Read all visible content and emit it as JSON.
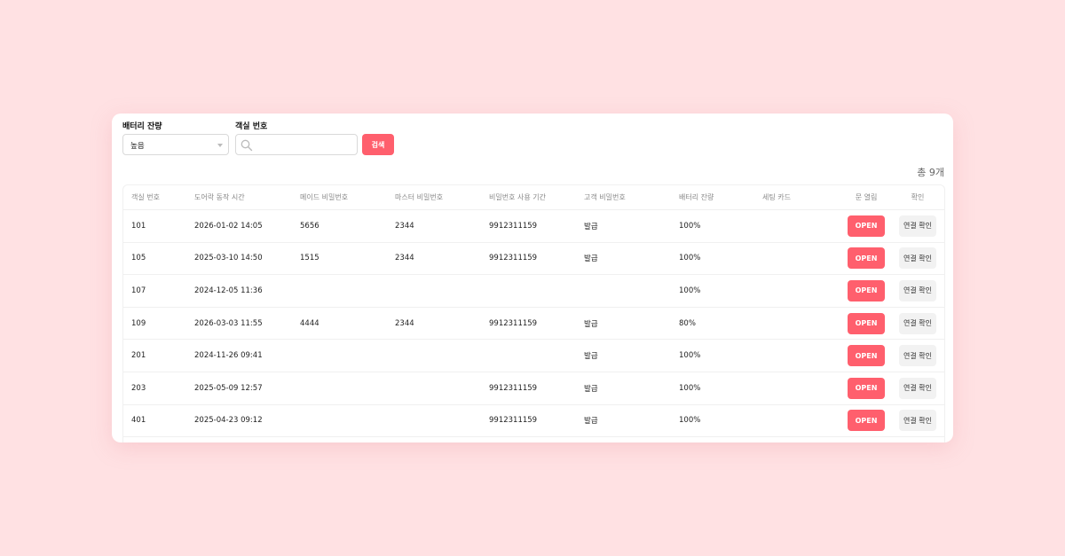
{
  "filters": {
    "battery_label": "배터리 잔량",
    "battery_value": "높음",
    "room_label": "객실 번호",
    "room_value": "",
    "search_button": "검색"
  },
  "total_count": "총 9개",
  "table": {
    "headers": [
      "객실 번호",
      "도어락 동작 시간",
      "메이드 비밀번호",
      "마스터 비밀번호",
      "비밀번호 사용 기간",
      "고객 비밀번호",
      "배터리 잔량",
      "세팅 카드",
      "문 열림",
      "확인"
    ],
    "open_label": "OPEN",
    "check_label": "연결 확인",
    "rows": [
      [
        "101",
        "2026-01-02 14:05",
        "5656",
        "2344",
        "9912311159",
        "발급",
        "100%",
        ""
      ],
      [
        "105",
        "2025-03-10 14:50",
        "1515",
        "2344",
        "9912311159",
        "발급",
        "100%",
        ""
      ],
      [
        "107",
        "2024-12-05 11:36",
        "",
        "",
        "",
        "",
        "100%",
        ""
      ],
      [
        "109",
        "2026-03-03 11:55",
        "4444",
        "2344",
        "9912311159",
        "발급",
        "80%",
        ""
      ],
      [
        "201",
        "2024-11-26 09:41",
        "",
        "",
        "",
        "발급",
        "100%",
        ""
      ],
      [
        "203",
        "2025-05-09 12:57",
        "",
        "",
        "9912311159",
        "발급",
        "100%",
        ""
      ],
      [
        "401",
        "2025-04-23 09:12",
        "",
        "",
        "9912311159",
        "발급",
        "100%",
        ""
      ]
    ]
  },
  "colors": {
    "background": "#ffe1e3",
    "accent": "#ff5f6d"
  }
}
